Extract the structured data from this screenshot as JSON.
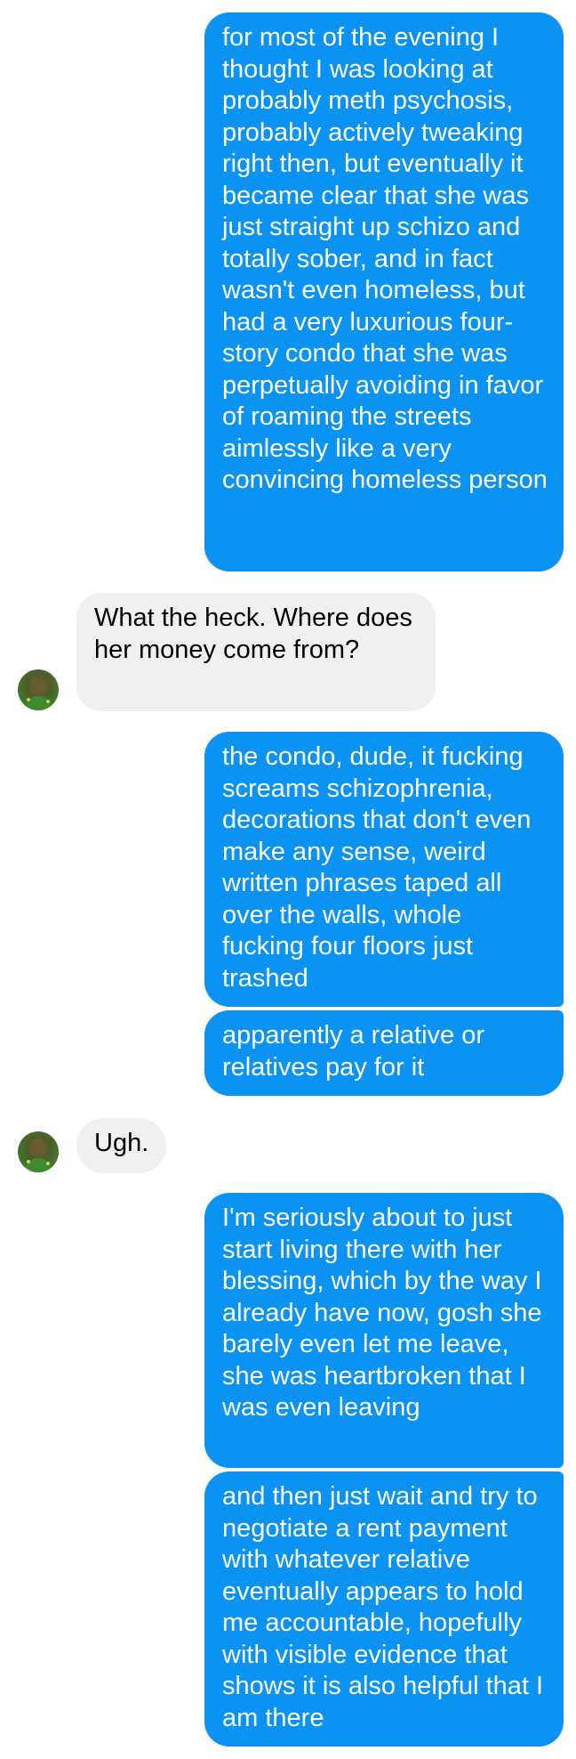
{
  "messages": [
    {
      "id": "m1",
      "direction": "outgoing",
      "text": "for most of the evening I thought I was looking at probably meth psychosis, probably actively tweaking right then, but eventually it became clear that she was just straight up schizo and totally sober, and in fact wasn't even homeless, but had a very luxurious four-story condo that she was perpetually avoiding in favor of roaming the streets aimlessly like a very convincing homeless person"
    },
    {
      "id": "m2",
      "direction": "incoming",
      "text": "What the heck. Where does her money come from?"
    },
    {
      "id": "m3",
      "direction": "outgoing",
      "text": "the condo, dude, it fucking screams schizophrenia, decorations that don't even make any sense, weird written phrases taped all over the walls, whole fucking four floors just trashed"
    },
    {
      "id": "m4",
      "direction": "outgoing",
      "text": "apparently a relative or relatives pay for it"
    },
    {
      "id": "m5",
      "direction": "incoming",
      "text": "Ugh."
    },
    {
      "id": "m6",
      "direction": "outgoing",
      "text": "I'm seriously about to just start living there with her blessing, which by the way I already have now, gosh she barely even let me leave, she was heartbroken that I was even leaving"
    },
    {
      "id": "m7",
      "direction": "outgoing",
      "text": "and then just wait and try to negotiate a rent payment with whatever relative eventually appears to hold me accountable, hopefully with visible evidence that shows it is also helpful that I am there"
    }
  ],
  "colors": {
    "outgoing_bubble": "#0a93f2",
    "incoming_bubble": "#f0f0f0",
    "background": "#ffffff"
  },
  "icons": {
    "avatar": "contact-avatar-icon"
  }
}
